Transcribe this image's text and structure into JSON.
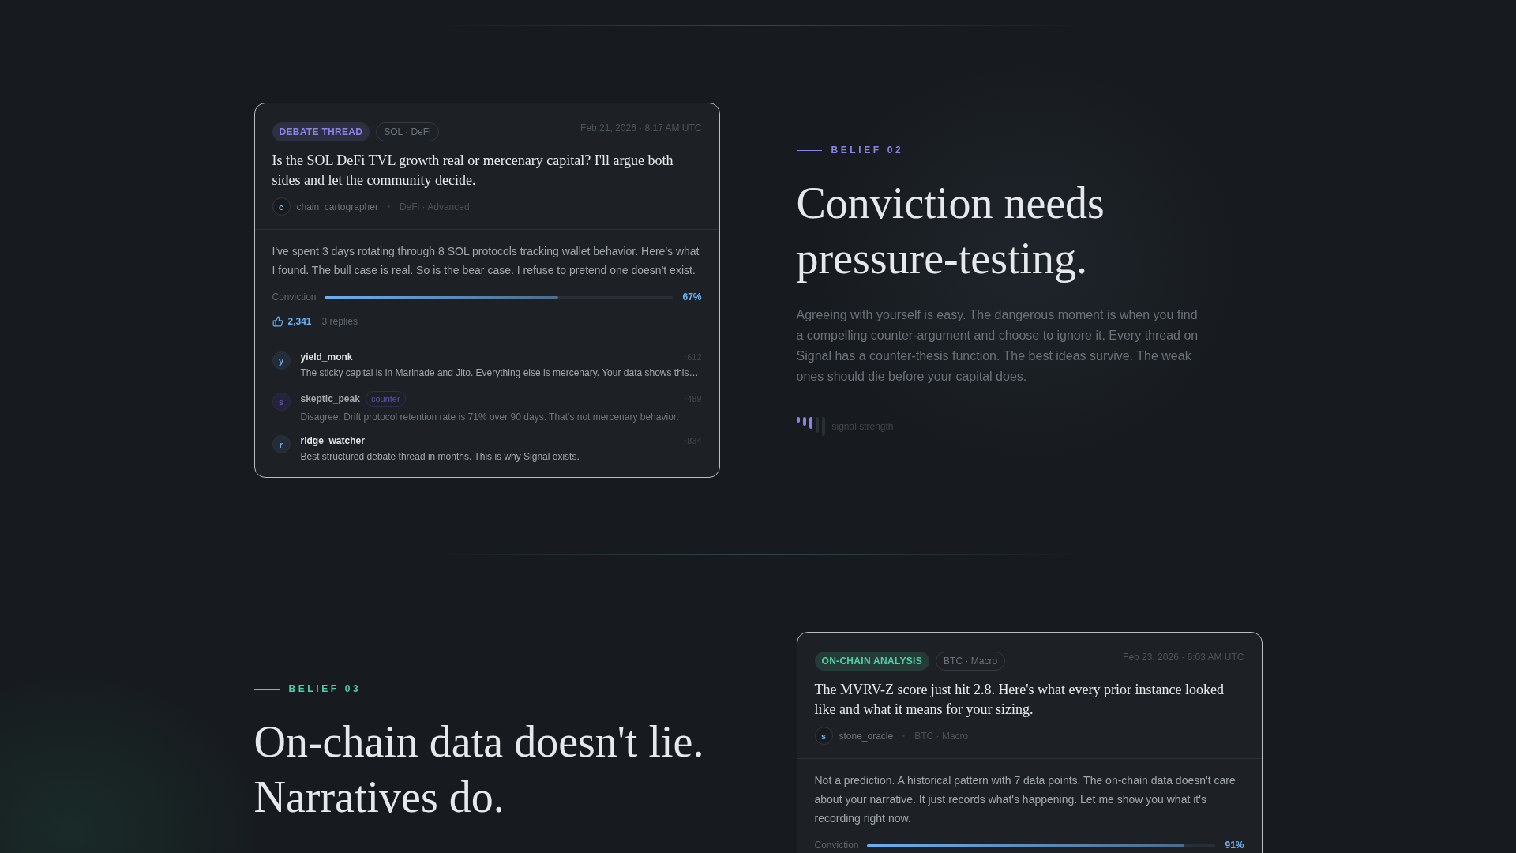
{
  "sections": [
    {
      "blocks": [
        {
          "kind": "post",
          "category": {
            "label": "DEBATE THREAD",
            "color": "#8b84e8"
          },
          "tag": "SOL · DeFi",
          "timestamp": "Feb 21, 2026 · 8:17 AM UTC",
          "title": "Is the SOL DeFi TVL growth real or mercenary capital? I'll argue both sides and let the community decide.",
          "author": {
            "initial": "c",
            "name": "chain_cartographer",
            "meta": "DeFi · Advanced"
          },
          "body": "I've spent 3 days rotating through 8 SOL protocols tracking wallet behavior. Here's what I found. The bull case is real. So is the bear case. I refuse to pretend one doesn't exist.",
          "conviction": {
            "label": "Conviction",
            "level": 0.67,
            "reading": "67%"
          },
          "likes": "2,341",
          "reply_count": "3 replies",
          "replies": [
            {
              "kind": "reply",
              "initial": "y",
              "name": "yield_monk",
              "votes": "↑612",
              "text": "The sticky capital is in Marinade and Jito. Everything else is mercenary. Your data shows this…"
            },
            {
              "kind": "counter",
              "initial": "s",
              "name": "skeptic_peak",
              "tag": "counter",
              "votes": "↑489",
              "text": "Disagree. Drift protocol retention rate is 71% over 90 days. That's not mercenary behavior."
            },
            {
              "kind": "reply",
              "initial": "r",
              "name": "ridge_watcher",
              "votes": "↑834",
              "text": "Best structured debate thread in months. This is why Signal exists."
            }
          ]
        },
        {
          "kind": "belief",
          "label": "BELIEF 02",
          "color": "#8b84e8",
          "heading": "Conviction needs pressure-testing.",
          "body": "Agreeing with yourself is easy. The dangerous moment is when you find a compelling counter-argument and choose to ignore it. Every thread on Signal has a counter-thesis function. The best ideas survive. The weak ones should die before your capital does.",
          "signal_label": "signal strength"
        }
      ]
    },
    {
      "blocks": [
        {
          "kind": "belief",
          "label": "BELIEF 03",
          "color": "#4fd1a5",
          "heading": "On-chain data doesn't lie. Narratives do."
        },
        {
          "kind": "post",
          "category": {
            "label": "ON-CHAIN ANALYSIS",
            "color": "#4fd1a5"
          },
          "tag": "BTC · Macro",
          "timestamp": "Feb 23, 2026 · 6:03 AM UTC",
          "title": "The MVRV-Z score just hit 2.8. Here's what every prior instance looked like and what it means for your sizing.",
          "author": {
            "initial": "s",
            "name": "stone_oracle",
            "meta": "BTC · Macro"
          },
          "body": "Not a prediction. A historical pattern with 7 data points. The on-chain data doesn't care about your narrative. It just records what's happening. Let me show you what it's recording right now.",
          "conviction": {
            "label": "Conviction",
            "level": 0.91,
            "reading": "91%"
          }
        }
      ]
    }
  ]
}
